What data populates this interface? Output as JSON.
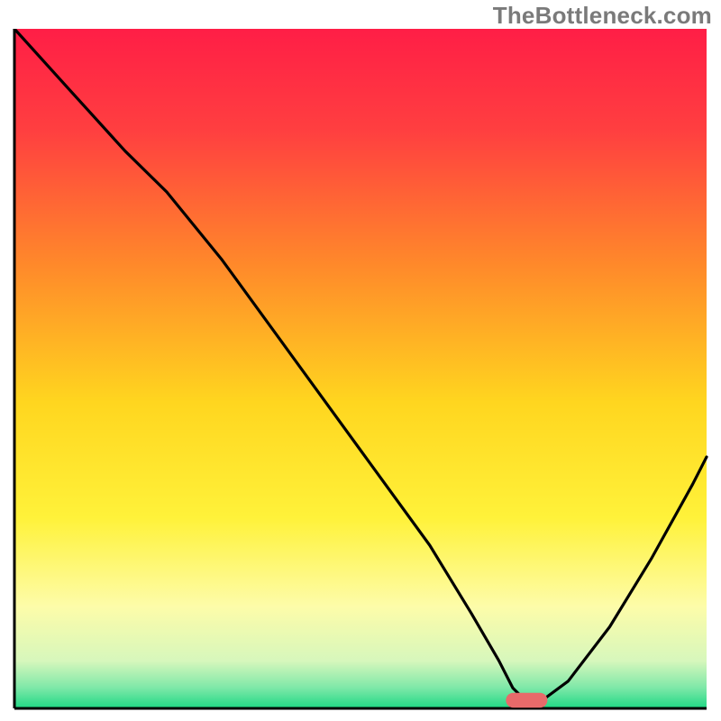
{
  "watermark": "TheBottleneck.com",
  "chart_data": {
    "type": "line",
    "title": "",
    "xlabel": "",
    "ylabel": "",
    "xlim": [
      0,
      100
    ],
    "ylim": [
      0,
      100
    ],
    "grid": false,
    "legend": false,
    "background": {
      "type": "vertical-gradient",
      "stops": [
        {
          "pos": 0.0,
          "color": "#ff1e46"
        },
        {
          "pos": 0.15,
          "color": "#ff3f40"
        },
        {
          "pos": 0.35,
          "color": "#ff8a2a"
        },
        {
          "pos": 0.55,
          "color": "#ffd61f"
        },
        {
          "pos": 0.72,
          "color": "#fff23a"
        },
        {
          "pos": 0.85,
          "color": "#fdfca9"
        },
        {
          "pos": 0.93,
          "color": "#d7f7bc"
        },
        {
          "pos": 0.97,
          "color": "#7de8a8"
        },
        {
          "pos": 1.0,
          "color": "#1fd885"
        }
      ]
    },
    "series": [
      {
        "name": "bottleneck-curve",
        "color": "#000000",
        "x": [
          0,
          8,
          16,
          22,
          30,
          40,
          50,
          60,
          66,
          70,
          72,
          74,
          76,
          80,
          86,
          92,
          98,
          100
        ],
        "y": [
          100,
          91,
          82,
          76,
          66,
          52,
          38,
          24,
          14,
          7,
          3,
          1,
          1,
          4,
          12,
          22,
          33,
          37
        ]
      }
    ],
    "marker": {
      "name": "optimal-range-marker",
      "shape": "rounded-rect",
      "color": "#e86a6a",
      "x_center": 74,
      "y_center": 1.2,
      "width_x_units": 6,
      "height_y_units": 2.2
    },
    "axes": {
      "left": {
        "color": "#000000",
        "width": 3
      },
      "bottom": {
        "color": "#000000",
        "width": 3
      }
    }
  }
}
